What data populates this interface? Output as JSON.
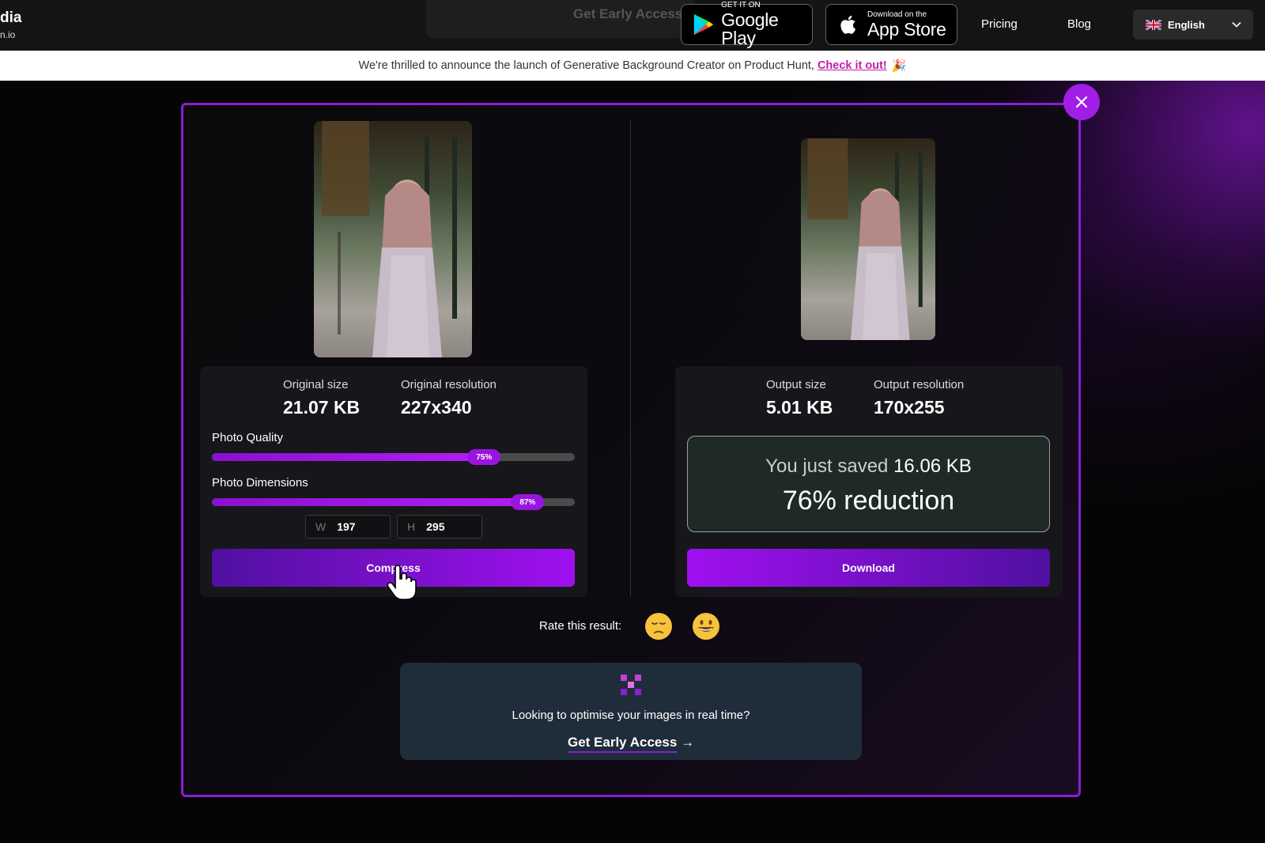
{
  "nav": {
    "logo_text": "dia",
    "logo_sub": "n.io",
    "ghost_cta": "Get Early Access",
    "google_play": {
      "small": "GET IT ON",
      "big": "Google Play"
    },
    "app_store": {
      "small": "Download on the",
      "big": "App Store"
    },
    "links": {
      "pricing": "Pricing",
      "blog": "Blog"
    },
    "language": "English"
  },
  "announcement": {
    "text": "We're thrilled to announce the launch of Generative Background Creator on Product Hunt,",
    "link": "Check it out!",
    "emoji": "🎉"
  },
  "original": {
    "size_label": "Original size",
    "size_value": "21.07 KB",
    "resolution_label": "Original resolution",
    "resolution_value": "227x340",
    "quality_label": "Photo Quality",
    "quality_pct": 75,
    "quality_text": "75%",
    "dimensions_label": "Photo Dimensions",
    "dimensions_pct": 87,
    "dimensions_text": "87%",
    "width_prefix": "W",
    "width_value": "197",
    "height_prefix": "H",
    "height_value": "295",
    "compress_label": "Compress"
  },
  "output": {
    "size_label": "Output size",
    "size_value": "5.01 KB",
    "resolution_label": "Output resolution",
    "resolution_value": "170x255",
    "saved_prefix": "You just saved",
    "saved_value": "16.06 KB",
    "reduction": "76% reduction",
    "download_label": "Download"
  },
  "rating": {
    "label": "Rate this result:",
    "bad_emoji": "😔",
    "good_emoji": "😀"
  },
  "promo": {
    "text": "Looking to optimise your images in real time?",
    "link": "Get Early Access",
    "arrow": "→"
  },
  "colors": {
    "accent": "#a11ee6",
    "modal_border": "#8a1ed6",
    "saved_box_bg": "#1f2a26",
    "promo_bg": "#1f2d3a"
  }
}
